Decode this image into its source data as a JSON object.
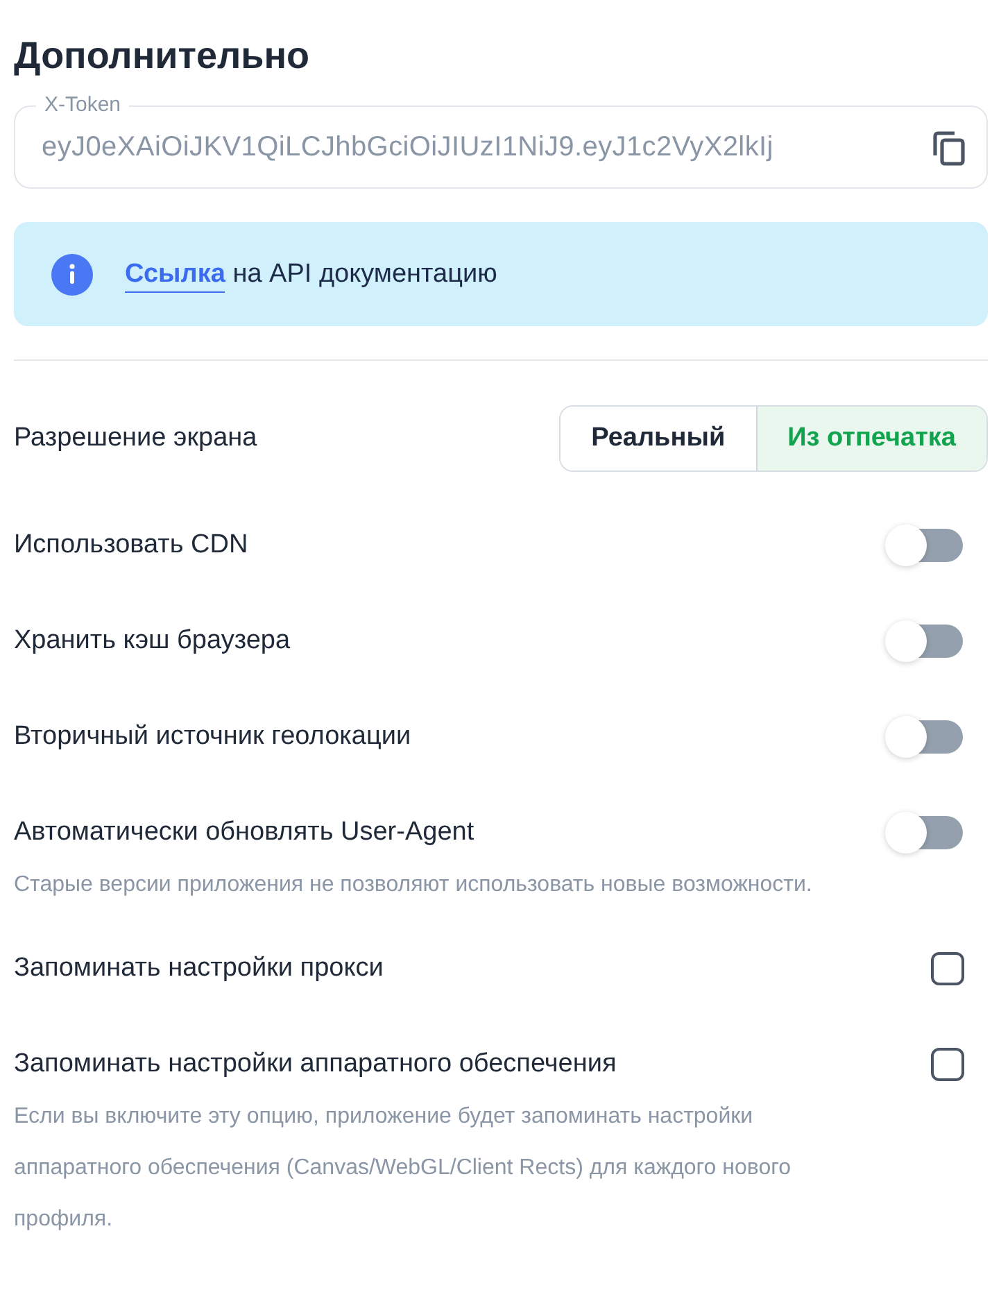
{
  "title": "Дополнительно",
  "token_field": {
    "label": "X-Token",
    "value": "eyJ0eXAiOiJKV1QiLCJhbGciOiJIUzI1NiJ9.eyJ1c2VyX2lkIj"
  },
  "info": {
    "link": "Ссылка",
    "text": "на API документацию"
  },
  "settings": [
    {
      "kind": "segmented",
      "label": "Разрешение экрана",
      "options": [
        {
          "label": "Реальный",
          "selected": false
        },
        {
          "label": "Из отпечатка",
          "selected": true
        }
      ]
    },
    {
      "kind": "toggle",
      "label": "Использовать CDN",
      "on": false
    },
    {
      "kind": "toggle",
      "label": "Хранить кэш браузера",
      "on": false
    },
    {
      "kind": "toggle",
      "label": "Вторичный источник геолокации",
      "on": false
    },
    {
      "kind": "toggle",
      "label": "Автоматически обновлять User-Agent",
      "on": false,
      "hint": "Старые версии приложения не позволяют использовать новые возможности."
    },
    {
      "kind": "checkbox",
      "label": "Запоминать настройки прокси",
      "checked": false
    },
    {
      "kind": "checkbox",
      "label": "Запоминать настройки аппаратного обеспечения",
      "checked": false,
      "hint": "Если вы включите эту опцию, приложение будет запоминать настройки аппаратного обеспечения (Canvas/WebGL/Client Rects) для каждого нового профиля."
    }
  ]
}
